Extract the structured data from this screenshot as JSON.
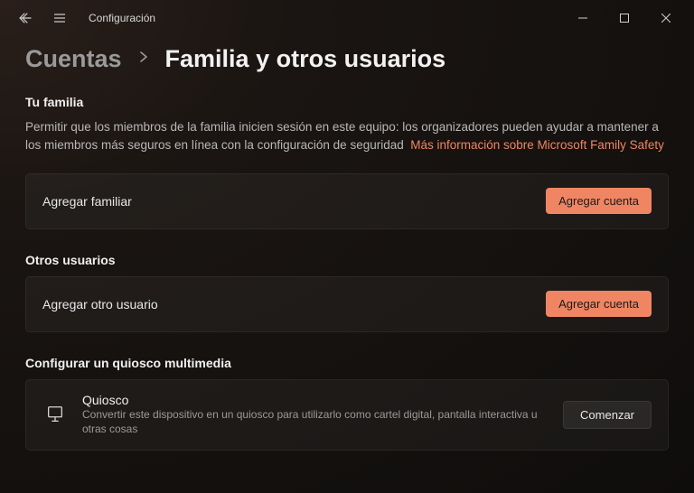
{
  "app": {
    "title": "Configuración"
  },
  "breadcrumb": {
    "parent": "Cuentas",
    "current": "Familia y otros usuarios"
  },
  "family": {
    "title": "Tu familia",
    "description": "Permitir que los miembros de la familia inicien sesión en este equipo: los organizadores pueden ayudar a mantener a los miembros más seguros en línea con la configuración de seguridad",
    "link": "Más información sobre Microsoft Family Safety",
    "add_label": "Agregar familiar",
    "add_button": "Agregar cuenta"
  },
  "others": {
    "title": "Otros usuarios",
    "add_label": "Agregar otro usuario",
    "add_button": "Agregar cuenta"
  },
  "kiosk": {
    "title": "Configurar un quiosco multimedia",
    "card_title": "Quiosco",
    "card_sub": "Convertir este dispositivo en un quiosco para utilizarlo como cartel digital, pantalla interactiva u otras cosas",
    "button": "Comenzar"
  }
}
